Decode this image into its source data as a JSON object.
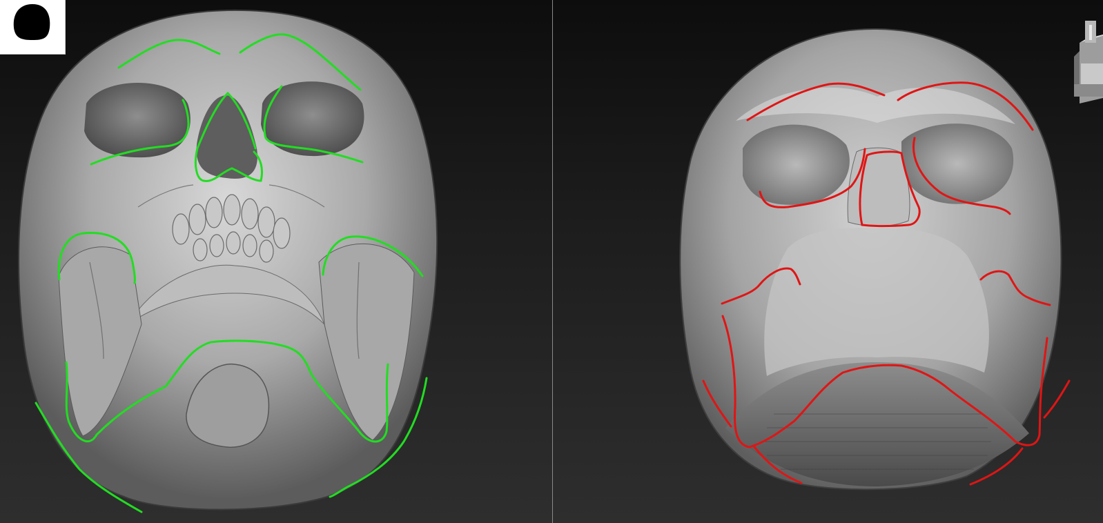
{
  "viewports": {
    "left": {
      "subject": "skull-model",
      "guide_color": "#22dd22"
    },
    "right": {
      "subject": "head-base-mesh",
      "guide_color": "#e01515"
    }
  },
  "icons": {
    "thumbnail": "silhouette-thumbnail-icon",
    "gizmo": "view-navigation-cube-icon"
  },
  "colors": {
    "background_top": "#0d0d0d",
    "background_bottom": "#2e2e2e",
    "divider": "#8a8a8a"
  }
}
